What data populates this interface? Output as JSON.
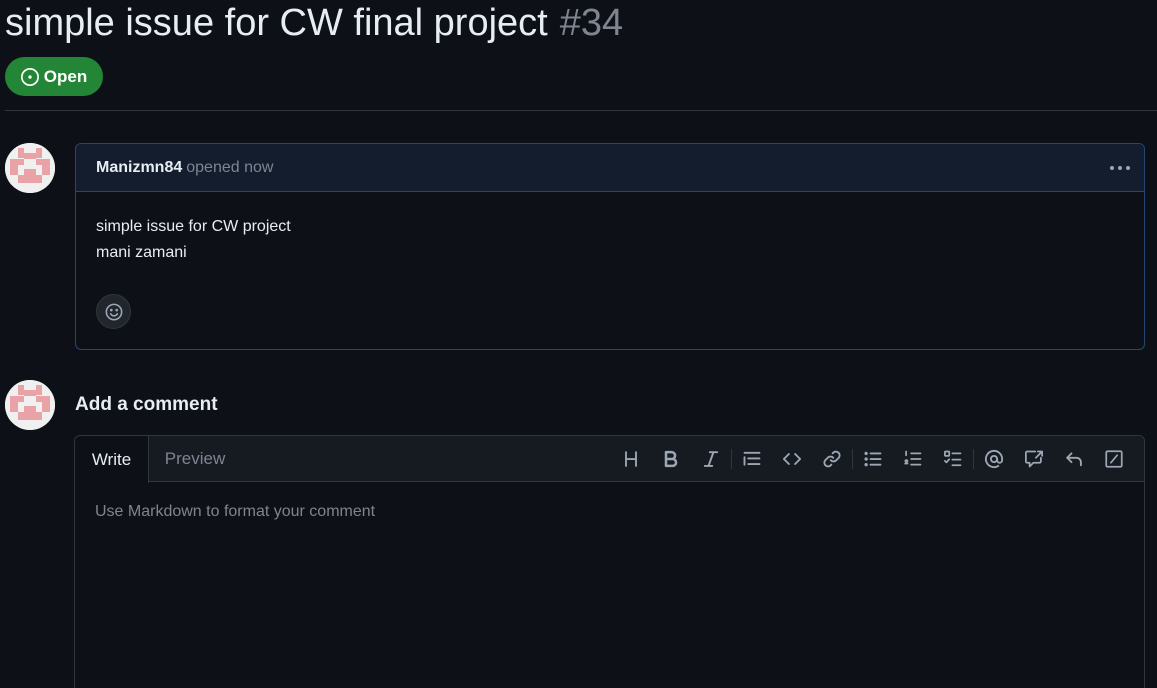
{
  "issue": {
    "title": "simple issue for CW final project",
    "number": "#34",
    "state": "Open"
  },
  "comment": {
    "author": "Manizmn84",
    "opened_text": "opened now",
    "body_lines": [
      "simple issue for CW project",
      "mani zamani"
    ]
  },
  "composer": {
    "heading": "Add a comment",
    "tabs": {
      "write": "Write",
      "preview": "Preview"
    },
    "placeholder": "Use Markdown to format your comment",
    "toolbar_icons": [
      "heading-icon",
      "bold-icon",
      "italic-icon",
      "quote-icon",
      "code-icon",
      "link-icon",
      "unordered-list-icon",
      "ordered-list-icon",
      "task-list-icon",
      "mention-icon",
      "cross-reference-icon",
      "saved-replies-icon",
      "slash-commands-icon"
    ]
  },
  "colors": {
    "background": "#0d1117",
    "open_badge": "#238636",
    "comment_header": "#131d2e",
    "muted_text": "#7d8590"
  }
}
